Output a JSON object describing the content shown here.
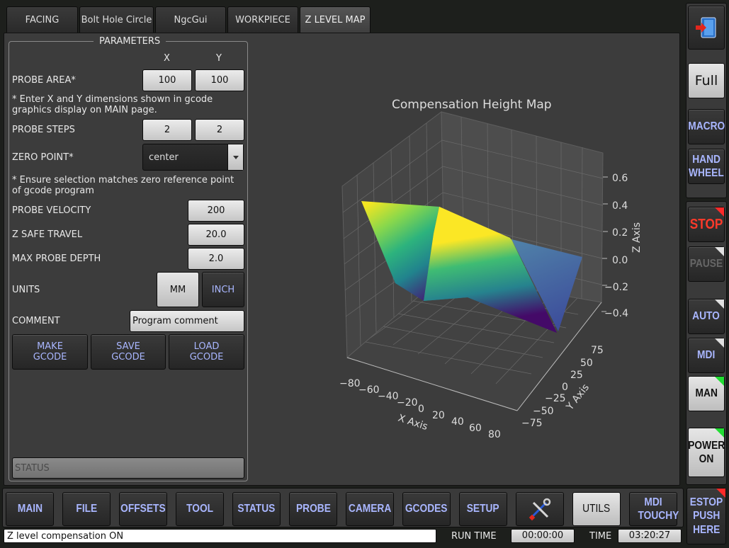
{
  "tabs": [
    {
      "label": "FACING",
      "active": false
    },
    {
      "label": "Bolt Hole Circle",
      "active": false
    },
    {
      "label": "NgcGui",
      "active": false
    },
    {
      "label": "WORKPIECE",
      "active": false
    },
    {
      "label": "Z LEVEL MAP",
      "active": true
    }
  ],
  "params": {
    "title": "PARAMETERS",
    "col_x": "X",
    "col_y": "Y",
    "probe_area_label": "PROBE AREA*",
    "probe_area_x": "100",
    "probe_area_y": "100",
    "probe_area_note": "* Enter X and Y dimensions shown in gcode graphics display on MAIN page.",
    "probe_steps_label": "PROBE STEPS",
    "probe_steps_x": "2",
    "probe_steps_y": "2",
    "zero_point_label": "ZERO POINT*",
    "zero_point_value": "center",
    "zero_point_note": "* Ensure selection matches zero reference point of gcode program",
    "probe_velocity_label": "PROBE VELOCITY",
    "probe_velocity": "200",
    "z_safe_label": "Z SAFE TRAVEL",
    "z_safe": "20.0",
    "max_depth_label": "MAX PROBE DEPTH",
    "max_depth": "2.0",
    "units_label": "UNITS",
    "unit_mm": "MM",
    "unit_inch": "INCH",
    "selected_unit": "MM",
    "comment_label": "COMMENT",
    "comment_value": "Program comment",
    "make_gcode": "MAKE GCODE",
    "save_gcode": "SAVE GCODE",
    "load_gcode": "LOAD GCODE",
    "status_placeholder": "STATUS"
  },
  "plot": {
    "title": "Compensation Height Map",
    "x_label": "X Axis",
    "y_label": "Y Axis",
    "z_label": "Z Axis",
    "x_ticks": [
      "−80",
      "−60",
      "−40",
      "−20",
      "0",
      "20",
      "40",
      "60",
      "80"
    ],
    "y_ticks": [
      "75",
      "50",
      "25",
      "0",
      "−25",
      "−50",
      "−75"
    ],
    "z_ticks": [
      "0.6",
      "0.4",
      "0.2",
      "0.0",
      "−0.2",
      "−0.4"
    ],
    "colormap": "viridis"
  },
  "chart_data": {
    "type": "surface-3d",
    "title": "Compensation Height Map",
    "xlabel": "X Axis",
    "ylabel": "Y Axis",
    "zlabel": "Z Axis",
    "xlim": [
      -90,
      90
    ],
    "ylim": [
      -90,
      90
    ],
    "zlim": [
      -0.5,
      0.7
    ],
    "x": [
      -50,
      0,
      50
    ],
    "y": [
      -50,
      0,
      50
    ],
    "z": [
      [
        -0.4,
        -0.45,
        -0.5
      ],
      [
        -0.2,
        -0.15,
        -0.05
      ],
      [
        0.4,
        0.25,
        0.05
      ]
    ],
    "colormap": "viridis",
    "grid": true
  },
  "sidebar": {
    "exit_icon": "exit-door-icon",
    "full": "Full",
    "macro": "MACRO",
    "hand_wheel_1": "HAND",
    "hand_wheel_2": "WHEEL",
    "stop": "STOP",
    "pause": "PAUSE",
    "auto": "AUTO",
    "mdi": "MDI",
    "man": "MAN",
    "power_1": "POWER",
    "power_2": "ON",
    "estop_1": "ESTOP",
    "estop_2": "PUSH",
    "estop_3": "HERE"
  },
  "bottom_nav": [
    {
      "label": "MAIN"
    },
    {
      "label": "FILE"
    },
    {
      "label": "OFFSETS"
    },
    {
      "label": "TOOL"
    },
    {
      "label": "STATUS"
    },
    {
      "label": "PROBE"
    },
    {
      "label": "CAMERA"
    },
    {
      "label": "GCODES"
    },
    {
      "label": "SETUP"
    },
    {
      "label": ""
    },
    {
      "label": "UTILS"
    },
    {
      "label": "MDI TOUCHY"
    }
  ],
  "statusbar": {
    "message": "Z level compensation ON",
    "run_time_label": "RUN TIME",
    "run_time": "00:00:00",
    "time_label": "TIME",
    "time": "03:20:27"
  },
  "colors": {
    "stop_red": "#ff3a2a",
    "accent_blue": "#a9b6ff",
    "corner_red": "#ff2a2a",
    "corner_green": "#22dd33"
  }
}
